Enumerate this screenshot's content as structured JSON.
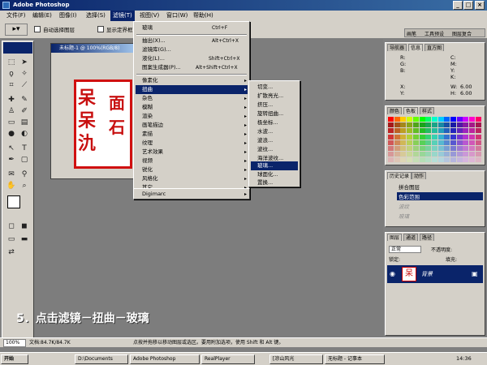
{
  "window": {
    "title": "Adobe Photoshop",
    "minimize": "_",
    "maximize": "□",
    "close": "×"
  },
  "menubar": [
    "文件(F)",
    "编辑(E)",
    "图像(I)",
    "选择(S)",
    "滤镜(T)",
    "视图(V)",
    "窗口(W)",
    "帮助(H)"
  ],
  "options": {
    "auto_select": "自动选择图层",
    "show_bounds": "显示定界框"
  },
  "palette_well": [
    "画笔",
    "工具预设",
    "图层复合"
  ],
  "document": {
    "title": "未标题-1 @ 100%(RGB/8)"
  },
  "filter_menu": [
    {
      "label": "玻璃",
      "shortcut": "Ctrl+F"
    },
    {
      "label": "抽出(X)...",
      "shortcut": "Alt+Ctrl+X"
    },
    {
      "label": "滤镜库(G)...",
      "shortcut": ""
    },
    {
      "label": "液化(L)...",
      "shortcut": "Shift+Ctrl+X"
    },
    {
      "label": "图案生成器(P)...",
      "shortcut": "Alt+Shift+Ctrl+X"
    },
    {
      "label": "像素化",
      "shortcut": ""
    },
    {
      "label": "扭曲",
      "shortcut": ""
    },
    {
      "label": "杂色",
      "shortcut": ""
    },
    {
      "label": "模糊",
      "shortcut": ""
    },
    {
      "label": "渲染",
      "shortcut": ""
    },
    {
      "label": "画笔描边",
      "shortcut": ""
    },
    {
      "label": "素描",
      "shortcut": ""
    },
    {
      "label": "纹理",
      "shortcut": ""
    },
    {
      "label": "艺术效果",
      "shortcut": ""
    },
    {
      "label": "视频",
      "shortcut": ""
    },
    {
      "label": "锐化",
      "shortcut": ""
    },
    {
      "label": "风格化",
      "shortcut": ""
    },
    {
      "label": "其它",
      "shortcut": ""
    },
    {
      "label": "Digimarc",
      "shortcut": ""
    }
  ],
  "distort_submenu": [
    "切变...",
    "扩散亮光...",
    "挤压...",
    "旋转扭曲...",
    "极坐标...",
    "水波...",
    "波浪...",
    "波纹...",
    "海洋波纹...",
    "玻璃...",
    "球面化...",
    "置换..."
  ],
  "navigator": {
    "tabs": [
      "导航器",
      "信息",
      "直方图"
    ],
    "r": "R:",
    "g": "G:",
    "b": "B:",
    "c": "C:",
    "m": "M:",
    "y": "Y:",
    "k": "K:",
    "x": "X:",
    "yy": "Y:",
    "w": "W:",
    "h": "H:",
    "w_val": "6.00",
    "h_val": "6.00"
  },
  "swatches": {
    "tabs": [
      "颜色",
      "色板",
      "样式"
    ]
  },
  "history": {
    "tabs": [
      "历史记录",
      "动作"
    ],
    "items": [
      "拼合图层",
      "色彩范围",
      "波纹",
      "玻璃"
    ]
  },
  "layers": {
    "tabs": [
      "图层",
      "通道",
      "路径"
    ],
    "mode": "正常",
    "opacity": "不透明度:",
    "lock": "锁定:",
    "fill": "填充:",
    "layer_name": "背景"
  },
  "caption": "5．点击滤镜－扭曲－玻璃",
  "status": {
    "zoom": "100%",
    "doc": "文档:84.7K/84.7K",
    "hint": "点按并拖移以移动图层或选区。要用附加选项，使用 Shift 和 Alt 键。"
  },
  "taskbar": {
    "start": "开始",
    "items": [
      "D:\\Documents",
      "Adobe Photoshop",
      "RealPlayer",
      "[凉山风光",
      "无标题 - 记事本"
    ],
    "clock": "14:36"
  },
  "colors": {
    "accent": "#0a246a",
    "chrome": "#d4d0c8",
    "workspace": "#7d7d7d",
    "stamp": "#c81010"
  }
}
